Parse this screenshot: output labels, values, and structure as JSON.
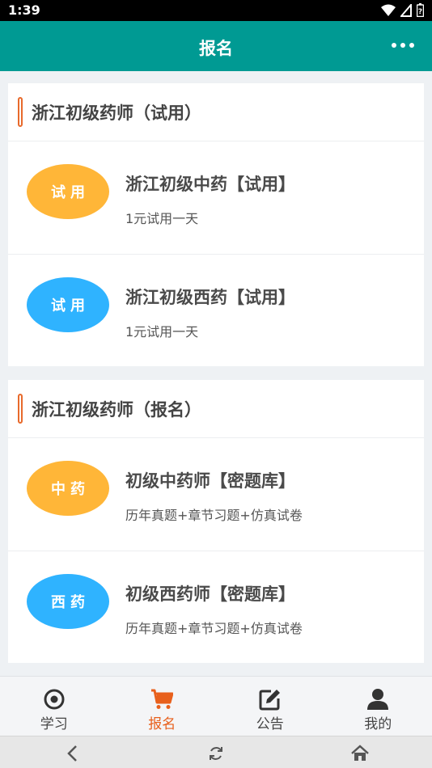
{
  "status_bar": {
    "time": "1:39"
  },
  "app_bar": {
    "title": "报名"
  },
  "sections": [
    {
      "title": "浙江初级药师（试用）",
      "items": [
        {
          "badge": "试用",
          "badge_color": "#ffb638",
          "title": "浙江初级中药【试用】",
          "subtitle": "1元试用一天"
        },
        {
          "badge": "试用",
          "badge_color": "#2fb3ff",
          "title": "浙江初级西药【试用】",
          "subtitle": "1元试用一天"
        }
      ]
    },
    {
      "title": "浙江初级药师（报名）",
      "items": [
        {
          "badge": "中药",
          "badge_color": "#ffb638",
          "title": "初级中药师【密题库】",
          "subtitle": "历年真题+章节习题+仿真试卷"
        },
        {
          "badge": "西药",
          "badge_color": "#2fb3ff",
          "title": "初级西药师【密题库】",
          "subtitle": "历年真题+章节习题+仿真试卷"
        }
      ]
    }
  ],
  "tabs": [
    {
      "label": "学习",
      "icon": "target-icon"
    },
    {
      "label": "报名",
      "icon": "cart-icon",
      "active": true
    },
    {
      "label": "公告",
      "icon": "edit-icon"
    },
    {
      "label": "我的",
      "icon": "person-icon"
    }
  ],
  "colors": {
    "primary": "#009a93",
    "accent": "#e8601c",
    "badge_orange": "#ffb638",
    "badge_blue": "#2fb3ff"
  }
}
